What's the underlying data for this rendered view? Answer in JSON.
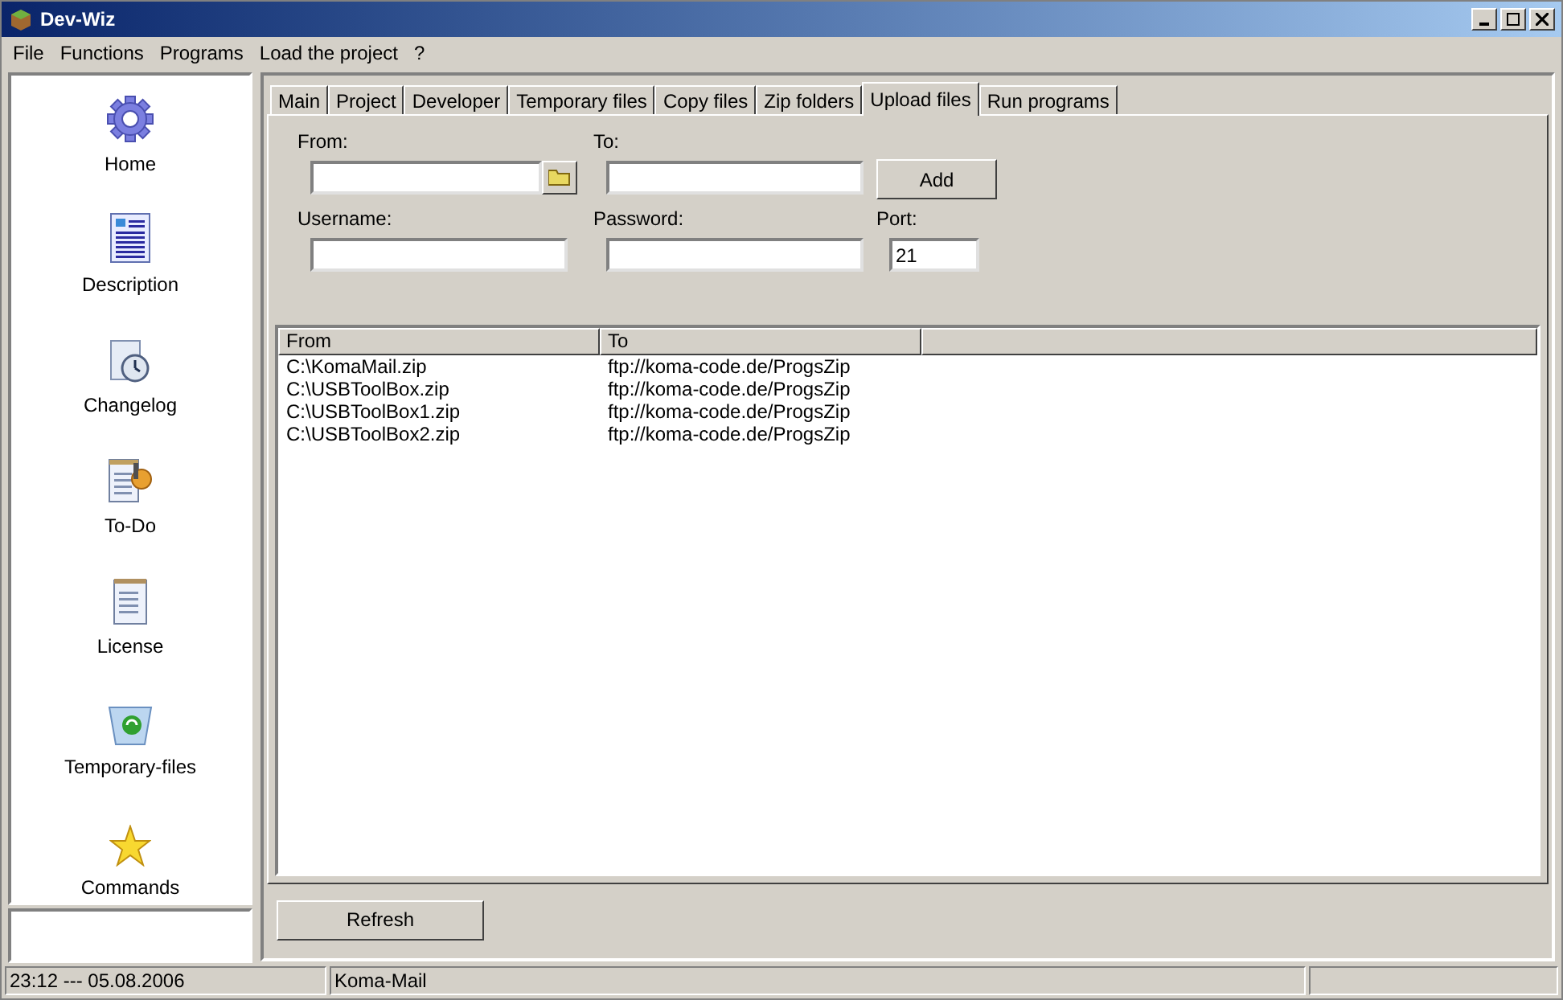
{
  "window": {
    "title": "Dev-Wiz"
  },
  "menu": [
    "File",
    "Functions",
    "Programs",
    "Load the project",
    "?"
  ],
  "sidebar": {
    "items": [
      {
        "label": "Home",
        "kind": "gear"
      },
      {
        "label": "Description",
        "kind": "document"
      },
      {
        "label": "Changelog",
        "kind": "clock"
      },
      {
        "label": "To-Do",
        "kind": "todo"
      },
      {
        "label": "License",
        "kind": "notepad"
      },
      {
        "label": "Temporary-files",
        "kind": "bin"
      },
      {
        "label": "Commands",
        "kind": "star"
      }
    ]
  },
  "tabs": [
    {
      "label": "Main",
      "selected": false
    },
    {
      "label": "Project",
      "selected": false
    },
    {
      "label": "Developer",
      "selected": false
    },
    {
      "label": "Temporary files",
      "selected": false
    },
    {
      "label": "Copy files",
      "selected": false
    },
    {
      "label": "Zip folders",
      "selected": false
    },
    {
      "label": "Upload files",
      "selected": true
    },
    {
      "label": "Run programs",
      "selected": false
    }
  ],
  "form": {
    "from_label": "From:",
    "to_label": "To:",
    "add_button": "Add",
    "username_label": "Username:",
    "password_label": "Password:",
    "port_label": "Port:",
    "port_value": "21"
  },
  "table": {
    "columns": [
      "From",
      "To"
    ],
    "rows": [
      [
        "C:\\KomaMail.zip",
        "ftp://koma-code.de/ProgsZip"
      ],
      [
        "C:\\USBToolBox.zip",
        "ftp://koma-code.de/ProgsZip"
      ],
      [
        "C:\\USBToolBox1.zip",
        "ftp://koma-code.de/ProgsZip"
      ],
      [
        "C:\\USBToolBox2.zip",
        "ftp://koma-code.de/ProgsZip"
      ]
    ]
  },
  "refresh_button": "Refresh",
  "status_bar": [
    "23:12 --- 05.08.2006",
    "Koma-Mail"
  ]
}
